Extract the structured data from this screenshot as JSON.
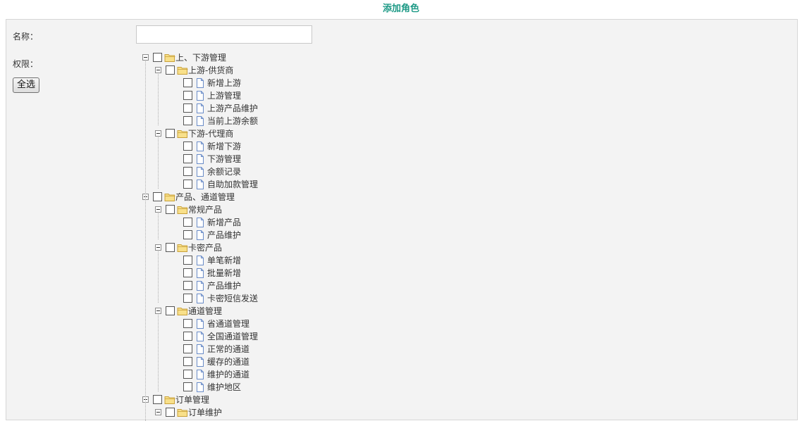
{
  "page": {
    "title": "添加角色"
  },
  "form": {
    "name_label": "名称：",
    "name_value": "",
    "permission_label": "权限：",
    "select_all_label": "全选"
  },
  "tree": [
    {
      "label": "上、下游管理",
      "children": [
        {
          "label": "上游-供货商",
          "children": [
            "新增上游",
            "上游管理",
            "上游产品维护",
            "当前上游余额"
          ]
        },
        {
          "label": "下游-代理商",
          "children": [
            "新增下游",
            "下游管理",
            "余额记录",
            "自助加款管理"
          ]
        }
      ]
    },
    {
      "label": "产品、通道管理",
      "children": [
        {
          "label": "常规产品",
          "children": [
            "新增产品",
            "产品维护"
          ]
        },
        {
          "label": "卡密产品",
          "children": [
            "单笔新增",
            "批量新增",
            "产品维护",
            "卡密短信发送"
          ]
        },
        {
          "label": "通道管理",
          "children": [
            "省通道管理",
            "全国通道管理",
            "正常的通道",
            "缓存的通道",
            "维护的通道",
            "维护地区"
          ]
        }
      ]
    },
    {
      "label": "订单管理",
      "children": [
        {
          "label": "订单维护",
          "children": []
        }
      ]
    }
  ],
  "icons": {
    "folder": "folder-icon",
    "page": "page-icon",
    "toggle": "minus-toggle-icon"
  },
  "colors": {
    "title": "#1e9a86",
    "panel_background": "#f3f3f3",
    "folder_fill": "#f8e08a",
    "folder_stroke": "#c9a13a",
    "page_stroke": "#6a8cc8"
  }
}
